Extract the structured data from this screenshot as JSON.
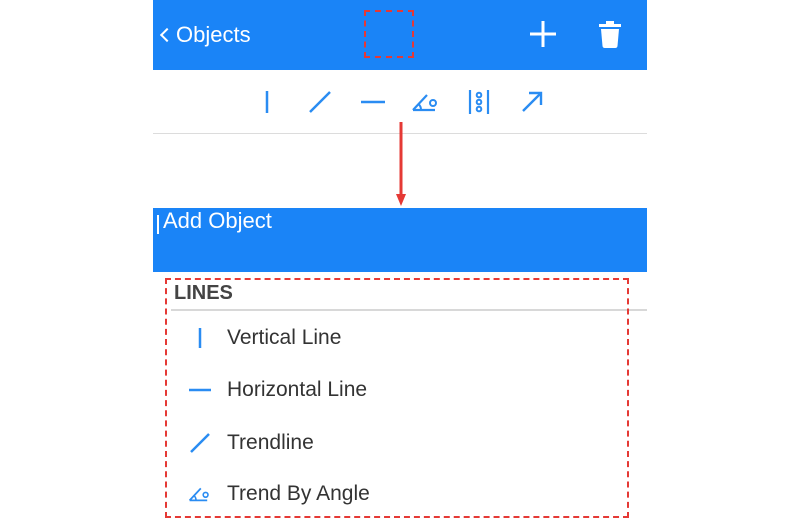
{
  "screen_top": {
    "back_label": "Objects",
    "icons": {
      "back": "chevron-left-icon",
      "add": "plus-icon",
      "delete": "trash-icon"
    },
    "toolbar_icons": [
      "vertical-line-icon",
      "trendline-icon",
      "horizontal-line-icon",
      "trend-by-angle-icon",
      "fibonacci-icon",
      "arrow-icon"
    ]
  },
  "screen_bottom": {
    "back_label": "Add Object",
    "section": "LINES",
    "items": [
      {
        "label": "Vertical Line",
        "icon": "vertical-line-icon"
      },
      {
        "label": "Horizontal Line",
        "icon": "horizontal-line-icon"
      },
      {
        "label": "Trendline",
        "icon": "trendline-icon"
      },
      {
        "label": "Trend By Angle",
        "icon": "trend-by-angle-icon"
      }
    ]
  },
  "colors": {
    "header_blue": "#1a84f7",
    "icon_blue": "#2a8cf2",
    "highlight_red": "#e53935"
  }
}
